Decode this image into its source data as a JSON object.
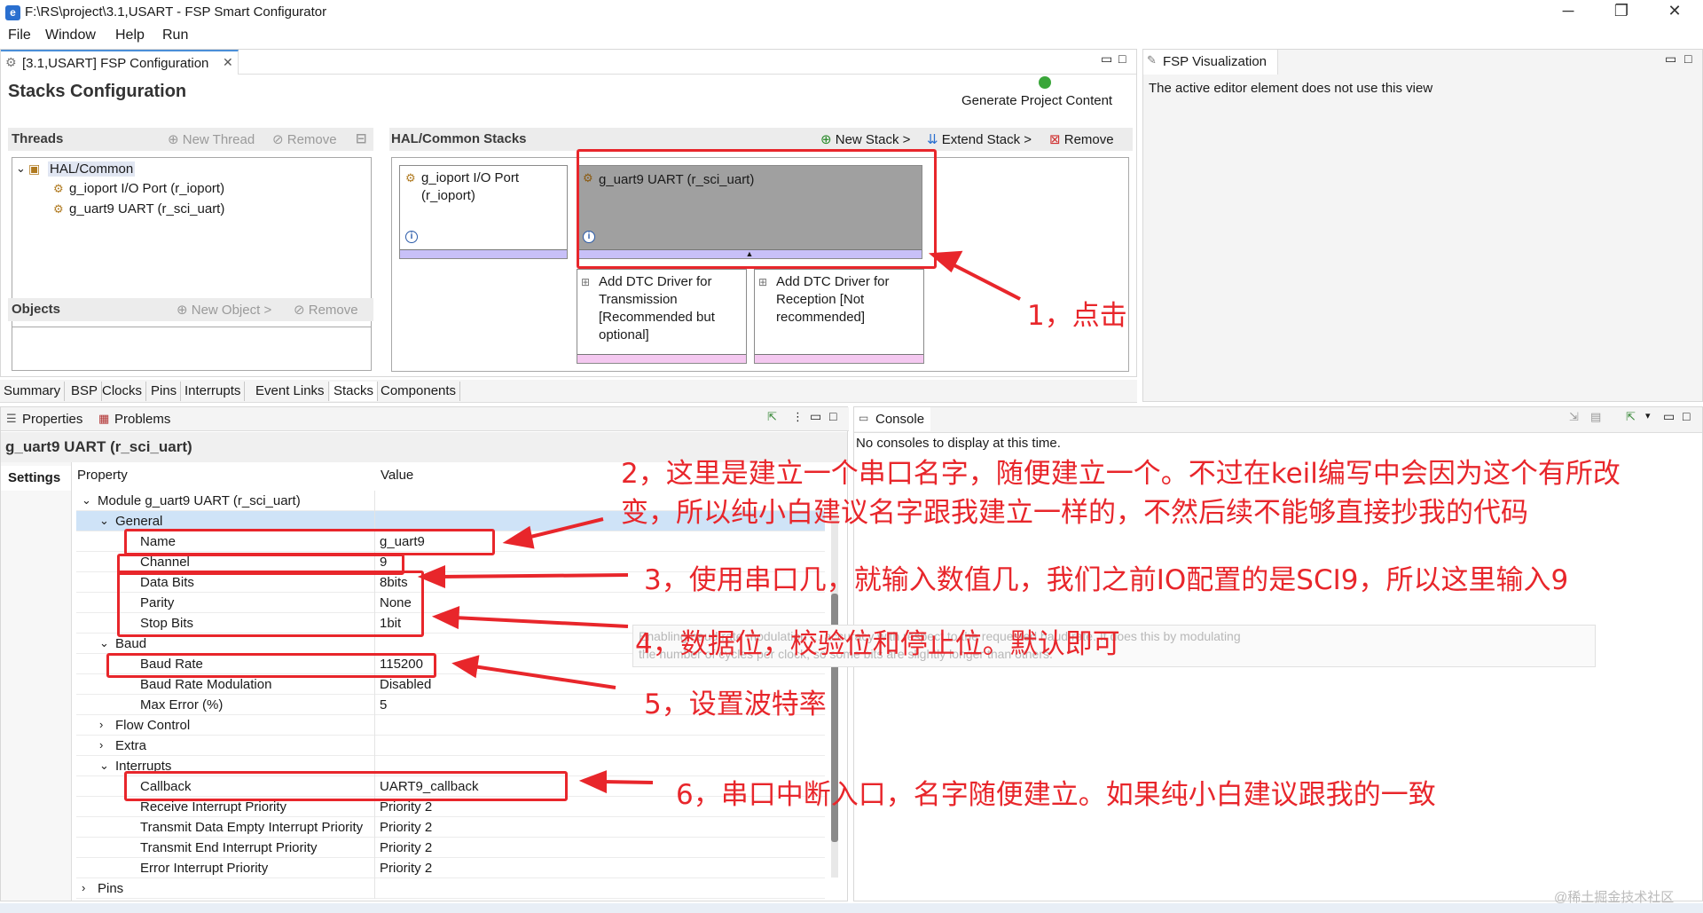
{
  "window": {
    "title": "F:\\RS\\project\\3.1,USART - FSP Smart Configurator",
    "minimize": "─",
    "maximize": "❐",
    "close": "✕"
  },
  "menu": [
    "File",
    "Window",
    "Help",
    "Run"
  ],
  "editor": {
    "tab": "[3.1,USART] FSP Configuration",
    "heading": "Stacks Configuration",
    "generate": "Generate Project Content"
  },
  "threads": {
    "title": "Threads",
    "new_thread": "New Thread",
    "remove": "Remove",
    "root": "HAL/Common",
    "items": [
      "g_ioport I/O Port (r_ioport)",
      "g_uart9 UART (r_sci_uart)"
    ]
  },
  "objects": {
    "title": "Objects",
    "new_object": "New Object >",
    "remove": "Remove"
  },
  "stacks": {
    "title": "HAL/Common Stacks",
    "new_stack": "New Stack >",
    "extend_stack": "Extend Stack >",
    "remove": "Remove",
    "cards": [
      {
        "l1": "g_ioport I/O Port",
        "l2": "(r_ioport)"
      },
      {
        "l1": "g_uart9 UART (r_sci_uart)"
      }
    ],
    "sub_cards": [
      {
        "l1": "Add DTC Driver for",
        "l2": "Transmission",
        "l3": "[Recommended but",
        "l4": "optional]"
      },
      {
        "l1": "Add DTC Driver for",
        "l2": "Reception [Not",
        "l3": "recommended]"
      }
    ],
    "info": "i",
    "expand": "▲"
  },
  "bottom_tabs": [
    "Summary",
    "BSP",
    "Clocks",
    "Pins",
    "Interrupts",
    "Event Links",
    "Stacks",
    "Components"
  ],
  "viz": {
    "tab": "FSP Visualization",
    "message": "The active editor element does not use this view"
  },
  "props": {
    "tab_properties": "Properties",
    "tab_problems": "Problems",
    "heading": "g_uart9 UART (r_sci_uart)",
    "settings": "Settings",
    "col_property": "Property",
    "col_value": "Value",
    "rows": [
      {
        "p": "Module g_uart9 UART (r_sci_uart)",
        "v": "",
        "e": "⌄"
      },
      {
        "p": "General",
        "v": "",
        "e": "⌄"
      },
      {
        "p": "Name",
        "v": "g_uart9"
      },
      {
        "p": "Channel",
        "v": "9"
      },
      {
        "p": "Data Bits",
        "v": "8bits"
      },
      {
        "p": "Parity",
        "v": "None"
      },
      {
        "p": "Stop Bits",
        "v": "1bit"
      },
      {
        "p": "Baud",
        "v": "",
        "e": "⌄"
      },
      {
        "p": "Baud Rate",
        "v": "115200"
      },
      {
        "p": "Baud Rate Modulation",
        "v": "Disabled"
      },
      {
        "p": "Max Error (%)",
        "v": "5"
      },
      {
        "p": "Flow Control",
        "v": "",
        "e": "›"
      },
      {
        "p": "Extra",
        "v": "",
        "e": "›"
      },
      {
        "p": "Interrupts",
        "v": "",
        "e": "⌄"
      },
      {
        "p": "Callback",
        "v": "UART9_callback"
      },
      {
        "p": "Receive Interrupt Priority",
        "v": "Priority 2"
      },
      {
        "p": "Transmit Data Empty Interrupt Priority",
        "v": "Priority 2"
      },
      {
        "p": "Transmit End Interrupt Priority",
        "v": "Priority 2"
      },
      {
        "p": "Error Interrupt Priority",
        "v": "Priority 2"
      },
      {
        "p": "Pins",
        "v": "",
        "e": "›"
      }
    ]
  },
  "console": {
    "tab": "Console",
    "message": "No consoles to display at this time.",
    "tooltip1": "Enabling baud rate modulation ... accuracy with respect to the requested baud rate. It does this by modulating",
    "tooltip2": "the number of cycles per clock, so some bits are slightly longer than others."
  },
  "annotations": {
    "n1": "1，点击",
    "n2a": "2，这里是建立一个串口名字，随便建立一个。不过在keil编写中会因为这个有所改",
    "n2b": "变，所以纯小白建议名字跟我建立一样的，不然后续不能够直接抄我的代码",
    "n3": "3，使用串口几，就输入数值几，我们之前IO配置的是SCI9，所以这里输入9",
    "n4": "4，数据位，校验位和停止位。默认即可",
    "n5": "5，设置波特率",
    "n6": "6，串口中断入口，名字随便建立。如果纯小白建议跟我的一致"
  },
  "watermark": "@稀土掘金技术社区",
  "colors": {
    "annotation": "#e8262b",
    "selected_card": "#a0a0a0",
    "card_bar_purple": "#c8c0f8",
    "card_bar_pink": "#f4c8f0",
    "selected_row": "#cfe3f7"
  }
}
